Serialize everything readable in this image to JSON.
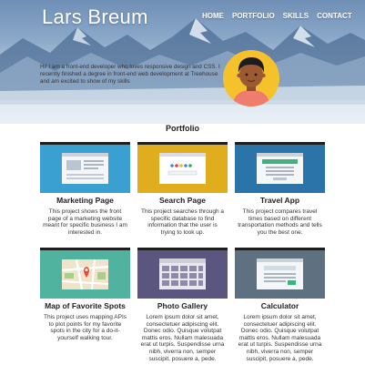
{
  "header": {
    "name": "Lars Breum",
    "nav": [
      "HOME",
      "PORTFOLIO",
      "SKILLS",
      "CONTACT"
    ],
    "bio": "Hi! I am a front-end developer who loves responsive design and CSS. I recently finished a degree in front-end web development at Treehouse and am excited to show of my skills"
  },
  "portfolio": {
    "title": "Portfolio",
    "projects": [
      {
        "title": "Marketing Page",
        "description": "This project shows the front page of a marketing website meant for specific business I am interested in.",
        "thumb_color": "#3aa0d2",
        "icon": "webpage-mockup-icon"
      },
      {
        "title": "Search Page",
        "description": "This project searches through a specific database to find information that the user is trying to look up.",
        "thumb_color": "#e0ad1e",
        "icon": "search-page-mockup-icon"
      },
      {
        "title": "Travel App",
        "description": "This project compares travel times based on different transportation methods and tells you the best one.",
        "thumb_color": "#2a74aa",
        "icon": "travel-app-mockup-icon"
      },
      {
        "title": "Map of Favorite Spots",
        "description": "This project uses mapping APIs to plot points for my favorite spots in the city for a do-it-yourself walking tour.",
        "thumb_color": "#4fb39f",
        "icon": "map-pin-icon"
      },
      {
        "title": "Photo Gallery",
        "description": "Lorem ipsum dolor sit amet, consectetuer adipiscing elit. Donec odio. Quisque volutpat mattis eros. Nullam malesuada erat ut turpis. Suspendisse urna nibh, viverra non, semper suscipit, posuere a, pede.",
        "thumb_color": "#5b5680",
        "icon": "photo-gallery-mockup-icon"
      },
      {
        "title": "Calculator",
        "description": "Lorem ipsum dolor sit amet, consectetuer adipiscing elit. Donec odio. Quisque volutpat mattis eros. Nullam malesuada erat ut turpis. Suspendisse urna nibh, viverra non, semper suscipit, posuere a, pede.",
        "thumb_color": "#5f7081",
        "icon": "calculator-mockup-icon"
      }
    ]
  }
}
